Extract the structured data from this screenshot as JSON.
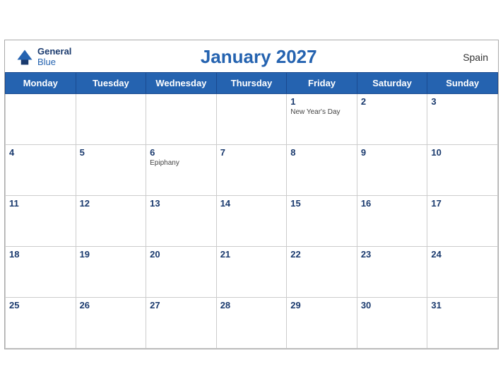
{
  "header": {
    "logo_line1": "General",
    "logo_line2": "Blue",
    "title": "January 2027",
    "country": "Spain"
  },
  "weekdays": [
    "Monday",
    "Tuesday",
    "Wednesday",
    "Thursday",
    "Friday",
    "Saturday",
    "Sunday"
  ],
  "weeks": [
    [
      {
        "day": "",
        "event": ""
      },
      {
        "day": "",
        "event": ""
      },
      {
        "day": "",
        "event": ""
      },
      {
        "day": "",
        "event": ""
      },
      {
        "day": "1",
        "event": "New Year's Day"
      },
      {
        "day": "2",
        "event": ""
      },
      {
        "day": "3",
        "event": ""
      }
    ],
    [
      {
        "day": "4",
        "event": ""
      },
      {
        "day": "5",
        "event": ""
      },
      {
        "day": "6",
        "event": "Epiphany"
      },
      {
        "day": "7",
        "event": ""
      },
      {
        "day": "8",
        "event": ""
      },
      {
        "day": "9",
        "event": ""
      },
      {
        "day": "10",
        "event": ""
      }
    ],
    [
      {
        "day": "11",
        "event": ""
      },
      {
        "day": "12",
        "event": ""
      },
      {
        "day": "13",
        "event": ""
      },
      {
        "day": "14",
        "event": ""
      },
      {
        "day": "15",
        "event": ""
      },
      {
        "day": "16",
        "event": ""
      },
      {
        "day": "17",
        "event": ""
      }
    ],
    [
      {
        "day": "18",
        "event": ""
      },
      {
        "day": "19",
        "event": ""
      },
      {
        "day": "20",
        "event": ""
      },
      {
        "day": "21",
        "event": ""
      },
      {
        "day": "22",
        "event": ""
      },
      {
        "day": "23",
        "event": ""
      },
      {
        "day": "24",
        "event": ""
      }
    ],
    [
      {
        "day": "25",
        "event": ""
      },
      {
        "day": "26",
        "event": ""
      },
      {
        "day": "27",
        "event": ""
      },
      {
        "day": "28",
        "event": ""
      },
      {
        "day": "29",
        "event": ""
      },
      {
        "day": "30",
        "event": ""
      },
      {
        "day": "31",
        "event": ""
      }
    ]
  ]
}
